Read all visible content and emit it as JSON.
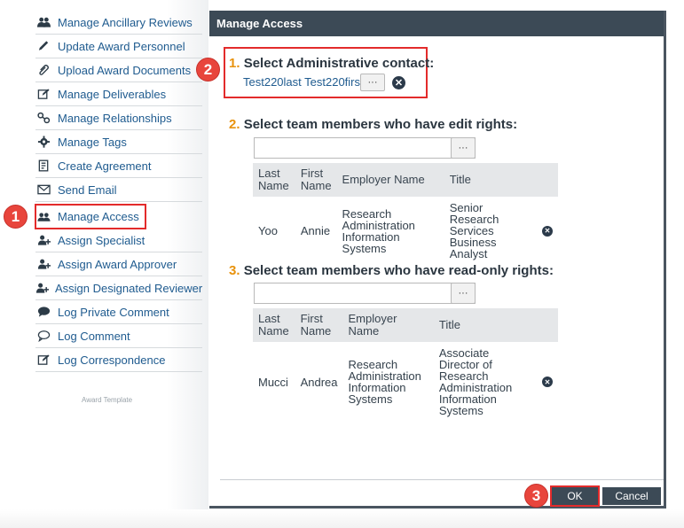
{
  "sidebar": {
    "items": [
      {
        "label": "Manage Ancillary Reviews",
        "icon": "people-icon"
      },
      {
        "label": "Update Award Personnel",
        "icon": "pencil-icon"
      },
      {
        "label": "Upload Award Documents",
        "icon": "paperclip-icon"
      },
      {
        "label": "Manage Deliverables",
        "icon": "edit-box-icon"
      },
      {
        "label": "Manage Relationships",
        "icon": "link-icon"
      },
      {
        "label": "Manage Tags",
        "icon": "gear-icon"
      },
      {
        "label": "Create Agreement",
        "icon": "document-icon"
      },
      {
        "label": "Send Email",
        "icon": "envelope-icon"
      },
      {
        "label": "Manage Access",
        "icon": "users-icon"
      },
      {
        "label": "Assign Specialist",
        "icon": "add-user-icon"
      },
      {
        "label": "Assign Award Approver",
        "icon": "add-user-icon"
      },
      {
        "label": "Assign Designated Reviewer",
        "icon": "add-user-icon"
      },
      {
        "label": "Log Private Comment",
        "icon": "speech-bubble-filled-icon"
      },
      {
        "label": "Log Comment",
        "icon": "speech-bubble-icon"
      },
      {
        "label": "Log Correspondence",
        "icon": "edit-box-icon"
      }
    ],
    "template_note": "Award Template"
  },
  "markers": {
    "one": "1",
    "two": "2",
    "three": "3"
  },
  "dialog": {
    "title": "Manage Access",
    "section1": {
      "num": "1.",
      "label": "Select Administrative contact:",
      "contact": "Test220last Test220first"
    },
    "section2": {
      "num": "2.",
      "label": "Select team members who have edit rights:"
    },
    "section3": {
      "num": "3.",
      "label": "Select team members who have read-only rights:"
    },
    "ellipsis": "···",
    "remove_glyph": "✕",
    "columns": [
      "Last Name",
      "First Name",
      "Employer Name",
      "Title"
    ],
    "edit_rows": [
      {
        "last": "Yoo",
        "first": "Annie",
        "employer": "Research Administration Information Systems",
        "title": "Senior Research Services Business Analyst"
      }
    ],
    "readonly_rows": [
      {
        "last": "Mucci",
        "first": "Andrea",
        "employer": "Research Administration Information Systems",
        "title": "Associate Director of Research Administration Information Systems"
      }
    ],
    "ok_label": "OK",
    "cancel_label": "Cancel"
  },
  "colors": {
    "accent_orange": "#e8920c",
    "link_blue": "#1f5b8f",
    "header_dark": "#3c4a56",
    "highlight_red": "#e32b2b"
  }
}
